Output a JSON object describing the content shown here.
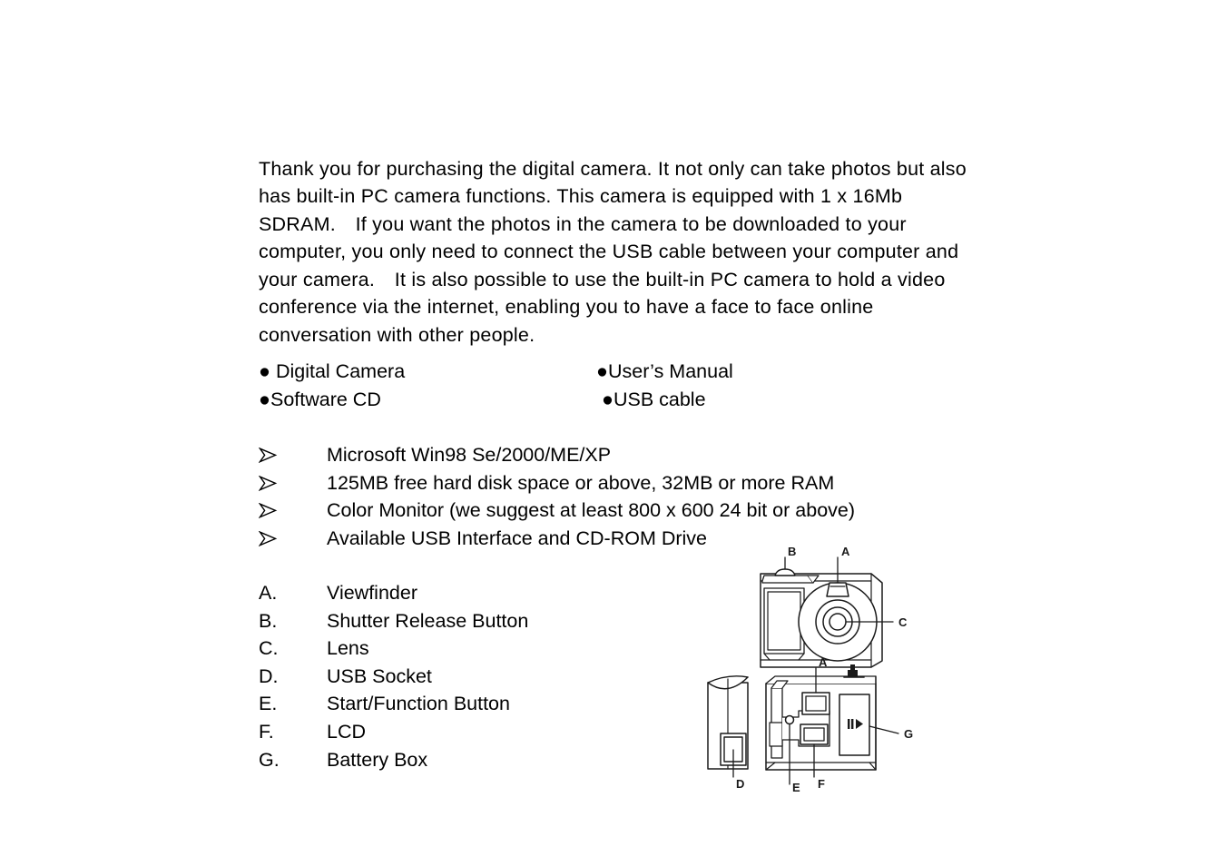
{
  "document": {
    "intro_paragraph": "Thank you for purchasing the digital camera. It not only can take photos but also has built-in PC camera functions. This camera is equipped with 1 x 16Mb SDRAM. If you want the photos in the camera to be downloaded to your computer, you only need to connect the USB cable between your computer and your camera. It is also possible to use the built-in PC camera to hold a video conference via the internet, enabling you to have a face to face online conversation with other people."
  },
  "package_contents": {
    "rows": [
      {
        "left": "● Digital Camera",
        "right": "●User’s Manual"
      },
      {
        "left": "●Software CD",
        "right": " ●USB cable"
      }
    ]
  },
  "system_requirements": {
    "bullet_icon": "wingding-arrow-bullet",
    "items": [
      "Microsoft Win98 Se/2000/ME/XP",
      "125MB free hard disk space or above, 32MB or more RAM",
      "Color Monitor (we suggest at least 800 x 600 24 bit or above)",
      "Available USB Interface and CD-ROM Drive"
    ]
  },
  "parts_list": {
    "items": [
      {
        "letter": "A.",
        "label": "Viewfinder"
      },
      {
        "letter": "B.",
        "label": "Shutter Release Button"
      },
      {
        "letter": "C.",
        "label": "Lens"
      },
      {
        "letter": "D.",
        "label": "USB Socket"
      },
      {
        "letter": "E.",
        "label": "Start/Function Button"
      },
      {
        "letter": "F.",
        "label": "LCD"
      },
      {
        "letter": "G.",
        "label": "Battery Box"
      }
    ]
  },
  "camera_diagram": {
    "views": {
      "front": "front-view",
      "side": "side-view",
      "rear": "rear-view"
    },
    "callouts": {
      "front_b": "B",
      "front_a": "A",
      "front_c": "C",
      "rear_a": "A",
      "rear_g": "G",
      "side_d": "D",
      "rear_e": "E",
      "rear_f": "F"
    },
    "line_color": "#000000"
  }
}
